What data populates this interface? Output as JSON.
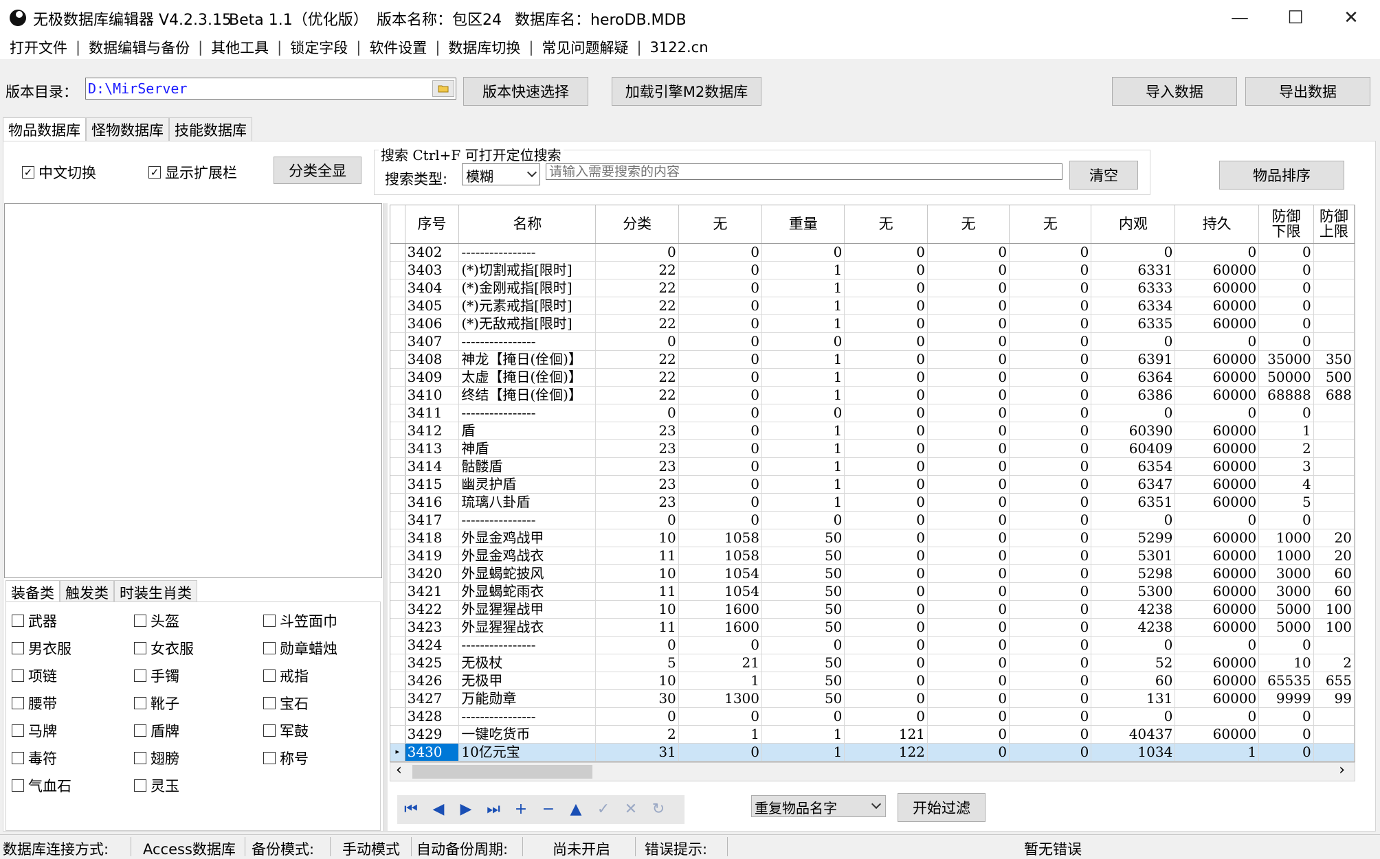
{
  "window": {
    "title": "无极数据库编辑器 V4.2.3.15",
    "beta": "Beta 1.1（优化版）",
    "version_name": "版本名称：包区24",
    "db_name": "数据库名：heroDB.MDB",
    "minimize": "—",
    "maximize": "☐",
    "close": "✕"
  },
  "menu": [
    "打开文件",
    "数据编辑与备份",
    "其他工具",
    "锁定字段",
    "软件设置",
    "数据库切换",
    "常见问题解疑",
    "3122.cn"
  ],
  "menu_sep": "|",
  "path": {
    "label": "版本目录：",
    "value": "D:\\MirServer",
    "quick_select": "版本快速选择",
    "load_m2": "加载引擎M2数据库",
    "import": "导入数据",
    "export": "导出数据"
  },
  "main_tabs": [
    "物品数据库",
    "怪物数据库",
    "技能数据库"
  ],
  "options": {
    "cn_switch": "中文切换",
    "show_ext": "显示扩展栏",
    "show_all": "分类全显",
    "check": "✓"
  },
  "search": {
    "title": "搜索   Ctrl+F 可打开定位搜索",
    "type_label": "搜索类型:",
    "type_value": "模糊",
    "placeholder": "请输入需要搜索的内容",
    "clear": "清空",
    "sort": "物品排序"
  },
  "category_tabs": [
    "装备类",
    "触发类",
    "时装生肖类"
  ],
  "categories": [
    [
      "武器",
      "头盔",
      "斗笠面巾"
    ],
    [
      "男衣服",
      "女衣服",
      "勋章蜡烛"
    ],
    [
      "项链",
      "手镯",
      "戒指"
    ],
    [
      "腰带",
      "靴子",
      "宝石"
    ],
    [
      "马牌",
      "盾牌",
      "军鼓"
    ],
    [
      "毒符",
      "翅膀",
      "称号"
    ],
    [
      "气血石",
      "灵玉"
    ]
  ],
  "grid": {
    "headers": [
      "序号",
      "名称",
      "分类",
      "无",
      "重量",
      "无",
      "无",
      "无",
      "内观",
      "持久",
      "防御\n下限",
      "防御\n上限"
    ],
    "rows": [
      [
        "3402",
        "----------------",
        "0",
        "0",
        "0",
        "0",
        "0",
        "0",
        "0",
        "0",
        "0",
        ""
      ],
      [
        "3403",
        "(*)切割戒指[限时]",
        "22",
        "0",
        "1",
        "0",
        "0",
        "0",
        "6331",
        "60000",
        "0",
        ""
      ],
      [
        "3404",
        "(*)金刚戒指[限时]",
        "22",
        "0",
        "1",
        "0",
        "0",
        "0",
        "6333",
        "60000",
        "0",
        ""
      ],
      [
        "3405",
        "(*)元素戒指[限时]",
        "22",
        "0",
        "1",
        "0",
        "0",
        "0",
        "6334",
        "60000",
        "0",
        ""
      ],
      [
        "3406",
        "(*)无敌戒指[限时]",
        "22",
        "0",
        "1",
        "0",
        "0",
        "0",
        "6335",
        "60000",
        "0",
        ""
      ],
      [
        "3407",
        "----------------",
        "0",
        "0",
        "0",
        "0",
        "0",
        "0",
        "0",
        "0",
        "0",
        ""
      ],
      [
        "3408",
        "神龙【掩日(佺佪)】",
        "22",
        "0",
        "1",
        "0",
        "0",
        "0",
        "6391",
        "60000",
        "35000",
        "350"
      ],
      [
        "3409",
        "太虚【掩日(佺佪)】",
        "22",
        "0",
        "1",
        "0",
        "0",
        "0",
        "6364",
        "60000",
        "50000",
        "500"
      ],
      [
        "3410",
        "终结【掩日(佺佪)】",
        "22",
        "0",
        "1",
        "0",
        "0",
        "0",
        "6386",
        "60000",
        "68888",
        "688"
      ],
      [
        "3411",
        "----------------",
        "0",
        "0",
        "0",
        "0",
        "0",
        "0",
        "0",
        "0",
        "0",
        ""
      ],
      [
        "3412",
        "盾",
        "23",
        "0",
        "1",
        "0",
        "0",
        "0",
        "60390",
        "60000",
        "1",
        ""
      ],
      [
        "3413",
        "神盾",
        "23",
        "0",
        "1",
        "0",
        "0",
        "0",
        "60409",
        "60000",
        "2",
        ""
      ],
      [
        "3414",
        "骷髅盾",
        "23",
        "0",
        "1",
        "0",
        "0",
        "0",
        "6354",
        "60000",
        "3",
        ""
      ],
      [
        "3415",
        "幽灵护盾",
        "23",
        "0",
        "1",
        "0",
        "0",
        "0",
        "6347",
        "60000",
        "4",
        ""
      ],
      [
        "3416",
        "琉璃八卦盾",
        "23",
        "0",
        "1",
        "0",
        "0",
        "0",
        "6351",
        "60000",
        "5",
        ""
      ],
      [
        "3417",
        "----------------",
        "0",
        "0",
        "0",
        "0",
        "0",
        "0",
        "0",
        "0",
        "0",
        ""
      ],
      [
        "3418",
        "外显金鸡战甲",
        "10",
        "1058",
        "50",
        "0",
        "0",
        "0",
        "5299",
        "60000",
        "1000",
        "20"
      ],
      [
        "3419",
        "外显金鸡战衣",
        "11",
        "1058",
        "50",
        "0",
        "0",
        "0",
        "5301",
        "60000",
        "1000",
        "20"
      ],
      [
        "3420",
        "外显蝎蛇披风",
        "10",
        "1054",
        "50",
        "0",
        "0",
        "0",
        "5298",
        "60000",
        "3000",
        "60"
      ],
      [
        "3421",
        "外显蝎蛇雨衣",
        "11",
        "1054",
        "50",
        "0",
        "0",
        "0",
        "5300",
        "60000",
        "3000",
        "60"
      ],
      [
        "3422",
        "外显猩猩战甲",
        "10",
        "1600",
        "50",
        "0",
        "0",
        "0",
        "4238",
        "60000",
        "5000",
        "100"
      ],
      [
        "3423",
        "外显猩猩战衣",
        "11",
        "1600",
        "50",
        "0",
        "0",
        "0",
        "4238",
        "60000",
        "5000",
        "100"
      ],
      [
        "3424",
        "----------------",
        "0",
        "0",
        "0",
        "0",
        "0",
        "0",
        "0",
        "0",
        "0",
        ""
      ],
      [
        "3425",
        "无极杖",
        "5",
        "21",
        "50",
        "0",
        "0",
        "0",
        "52",
        "60000",
        "10",
        "2"
      ],
      [
        "3426",
        "无极甲",
        "10",
        "1",
        "50",
        "0",
        "0",
        "0",
        "60",
        "60000",
        "65535",
        "655"
      ],
      [
        "3427",
        "万能勋章",
        "30",
        "1300",
        "50",
        "0",
        "0",
        "0",
        "131",
        "60000",
        "9999",
        "99"
      ],
      [
        "3428",
        "----------------",
        "0",
        "0",
        "0",
        "0",
        "0",
        "0",
        "0",
        "0",
        "0",
        ""
      ],
      [
        "3429",
        "一键吃货币",
        "2",
        "1",
        "1",
        "121",
        "0",
        "0",
        "40437",
        "60000",
        "0",
        ""
      ],
      [
        "3430",
        "10亿元宝",
        "31",
        "0",
        "1",
        "122",
        "0",
        "0",
        "1034",
        "1",
        "0",
        ""
      ]
    ],
    "selected_row": 28,
    "row_marker": "▸"
  },
  "scroll": {
    "left": "‹",
    "right": "›"
  },
  "nav_icons": [
    {
      "name": "first-record-icon",
      "glyph": "⏮"
    },
    {
      "name": "prev-record-icon",
      "glyph": "◀"
    },
    {
      "name": "next-record-icon",
      "glyph": "▶"
    },
    {
      "name": "last-record-icon",
      "glyph": "⏭"
    },
    {
      "name": "add-record-icon",
      "glyph": "+"
    },
    {
      "name": "delete-record-icon",
      "glyph": "−"
    },
    {
      "name": "edit-record-icon",
      "glyph": "▲"
    },
    {
      "name": "post-record-icon",
      "glyph": "✓"
    },
    {
      "name": "cancel-record-icon",
      "glyph": "✕"
    },
    {
      "name": "refresh-record-icon",
      "glyph": "↻"
    }
  ],
  "filter": {
    "type_value": "重复物品名字",
    "start": "开始过滤"
  },
  "status": {
    "conn_label": "数据库连接方式:",
    "conn_value": "Access数据库",
    "backup_label": "备份模式:",
    "backup_value": "手动模式",
    "auto_label": "自动备份周期:",
    "auto_value": "尚未开启",
    "error_label": "错误提示:",
    "error_value": "暂无错误"
  },
  "colors": {
    "accent": "#0078d7",
    "selected_row": "#cce4f7",
    "path_text": "#1a1aff",
    "nav_icon": "#1a4fb5"
  }
}
